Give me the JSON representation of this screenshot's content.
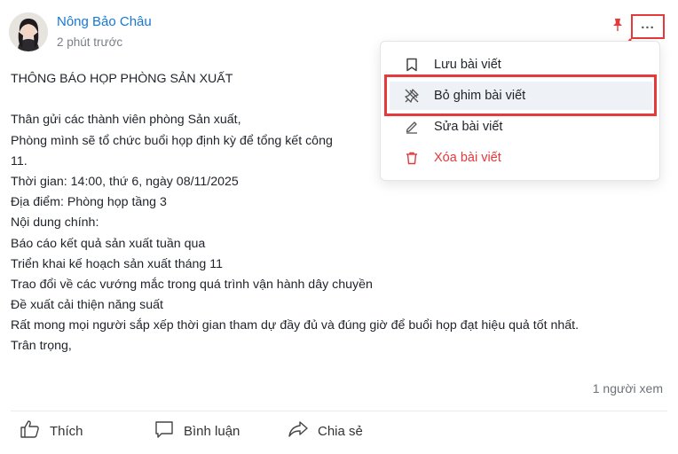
{
  "post": {
    "author": "Nông Bảo Châu",
    "time": "2 phút trước",
    "body_lines": [
      "THÔNG BÁO HỌP PHÒNG SẢN XUẤT",
      "",
      "Thân gửi các thành viên phòng Sản xuất,",
      "Phòng mình sẽ tổ chức buổi họp định kỳ để tổng kết công",
      "11.",
      "Thời gian: 14:00, thứ 6, ngày 08/11/2025",
      "Địa điểm: Phòng họp tầng 3",
      "Nội dung chính:",
      "Báo cáo kết quả sản xuất tuần qua",
      "Triển khai kế hoạch sản xuất tháng 11",
      "Trao đổi về các vướng mắc trong quá trình vận hành dây chuyền",
      "Đề xuất cải thiện năng suất",
      "Rất mong mọi người sắp xếp thời gian tham dự đầy đủ và đúng giờ để buổi họp đạt hiệu quả tốt nhất.",
      "Trân trọng,"
    ],
    "views": "1 người xem"
  },
  "header": {
    "more_label": "..."
  },
  "menu": {
    "items": [
      {
        "label": "Lưu bài viết",
        "icon": "bookmark-icon"
      },
      {
        "label": "Bỏ ghim bài viết",
        "icon": "unpin-icon"
      },
      {
        "label": "Sửa bài viết",
        "icon": "edit-icon"
      },
      {
        "label": "Xóa bài viết",
        "icon": "trash-icon"
      }
    ]
  },
  "actions": {
    "like": "Thích",
    "comment": "Bình luận",
    "share": "Chia sẻ"
  },
  "colors": {
    "accent": "#1677d8",
    "danger": "#e5393c",
    "highlight_bg": "#eef2f6"
  }
}
